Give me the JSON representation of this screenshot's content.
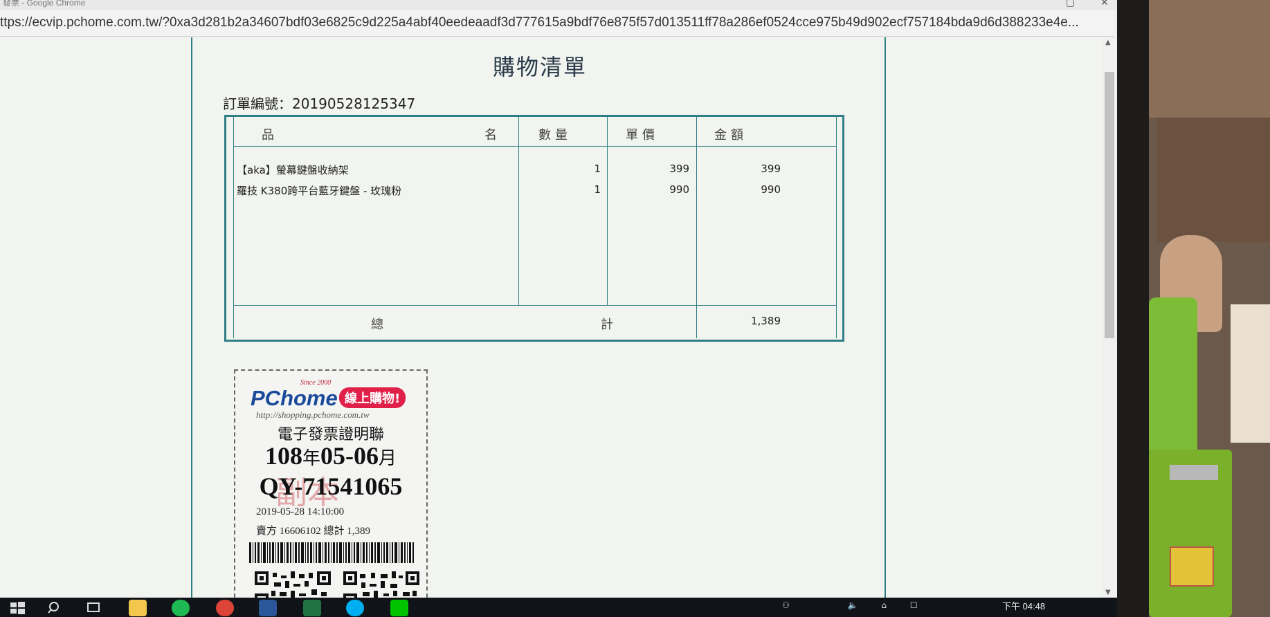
{
  "browser": {
    "window_title": "發票 - Google Chrome",
    "url": "ttps://ecvip.pchome.com.tw/?0xa3d281b2a34607bdf03e6825c9d225a4abf40eedeaadf3d777615a9bdf76e875f57d013511ff78a286ef0524cce975b49d902ecf757184bda9d6d388233e4e..."
  },
  "page": {
    "title": "購物清單",
    "order_label": "訂單編號：",
    "order_number": "20190528125347",
    "table": {
      "headers": {
        "name_left": "品",
        "name_right": "名",
        "qty": "數量",
        "unit_price": "單價",
        "amount": "金額"
      },
      "rows": [
        {
          "name": "【aka】螢幕鍵盤收納架",
          "qty": "1",
          "unit_price": "399",
          "amount": "399"
        },
        {
          "name": "羅技 K380跨平台藍牙鍵盤 - 玫瑰粉",
          "qty": "1",
          "unit_price": "990",
          "amount": "990"
        }
      ],
      "total_left": "總",
      "total_right": "計",
      "total_value": "1,389"
    }
  },
  "receipt": {
    "logo_text": "PChome",
    "logo_since": "Since 2000",
    "logo_tag": "線上購物!",
    "url": "http://shopping.pchome.com.tw",
    "title": "電子發票證明聯",
    "period_year": "108",
    "period_year_unit": "年",
    "period_months": "05-06",
    "period_month_unit": "月",
    "invoice_number": "QY-71541065",
    "copy_mark": "副本",
    "datetime": "2019-05-28  14:10:00",
    "seller": "賣方  16606102    總計  1,389"
  },
  "taskbar": {
    "clock": "下午 04:48",
    "colors": {
      "spotify": "#1db954",
      "chrome": "#db4437",
      "word": "#2b579a",
      "excel": "#217346",
      "skype": "#00aff0",
      "line": "#00c300",
      "explorer": "#f3c74b"
    }
  }
}
